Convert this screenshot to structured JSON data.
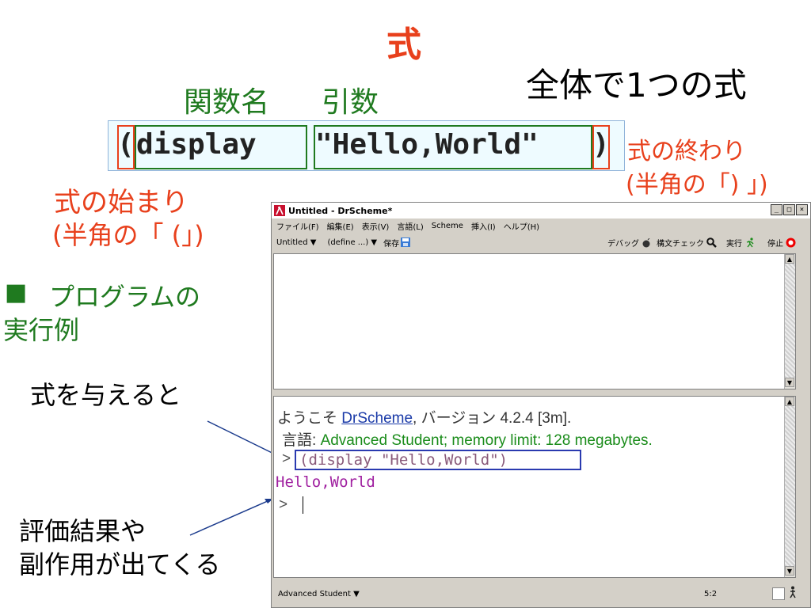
{
  "slide": {
    "heading": "式",
    "whole_expression": "全体で1つの式",
    "func_name_label": "関数名",
    "arg_label": "引数",
    "code": {
      "open_paren": "(",
      "func_name": "display",
      "argument": "\"Hello,World\"",
      "close_paren": ")"
    },
    "end_label": "式の終わり",
    "end_sub": "(半角の「) 」)",
    "start_label": "式の始まり",
    "start_sub": "(半角の「 (」)",
    "example_bullet": "■",
    "example_title_line1": "プログラムの",
    "example_title_line2": "実行例",
    "give_expr": "式を与えると",
    "result_line1": "評価結果や",
    "result_line2": "副作用が出てくる"
  },
  "window": {
    "title": "Untitled - DrScheme*",
    "menu": [
      "ファイル(F)",
      "編集(E)",
      "表示(V)",
      "言語(L)",
      "Scheme",
      "挿入(I)",
      "ヘルプ(H)"
    ],
    "toolbar": {
      "untitled": "Untitled ▼",
      "define": "(define ...) ▼",
      "save": "保存",
      "debug": "デバッグ",
      "syntax_check": "構文チェック",
      "run": "実行",
      "stop": "停止"
    },
    "interactions": {
      "welcome_prefix": "ようこそ ",
      "welcome_link": "DrScheme",
      "welcome_suffix": ", バージョン 4.2.4 [3m].",
      "lang_prefix": "言語: ",
      "lang_name": "Advanced Student; memory limit: 128 megabytes.",
      "prompt1": ">",
      "input_expr": "(display \"Hello,World\")",
      "output": "Hello,World",
      "prompt2": ">"
    },
    "status": {
      "language": "Advanced Student ▼",
      "position": "5:2"
    }
  }
}
